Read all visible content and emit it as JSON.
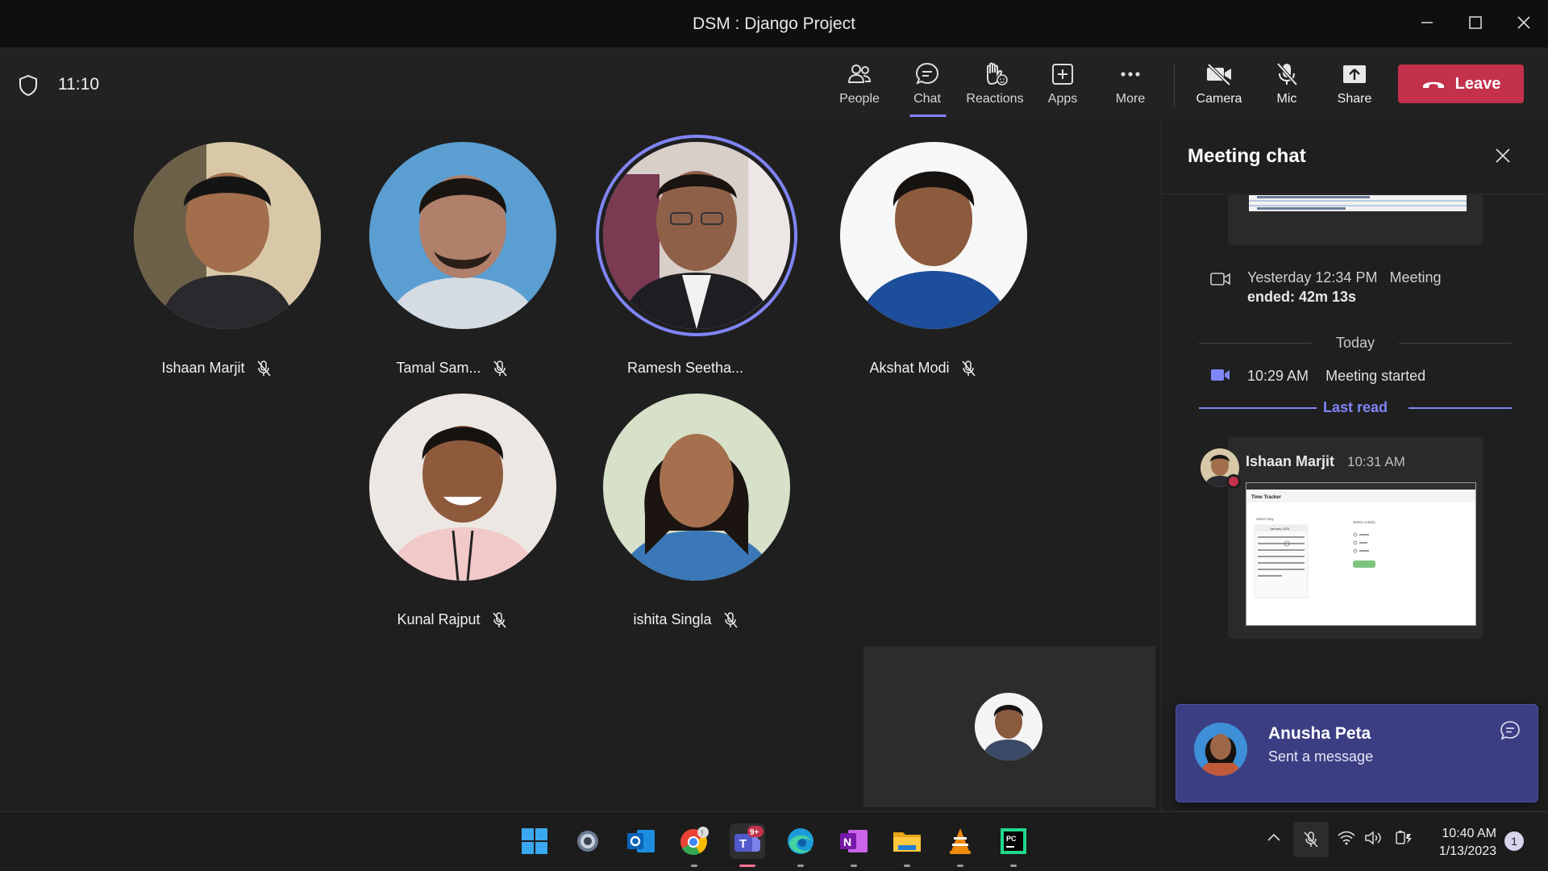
{
  "window": {
    "title": "DSM : Django Project"
  },
  "toolbar": {
    "timer": "11:10",
    "buttons": {
      "people": "People",
      "chat": "Chat",
      "reactions": "Reactions",
      "apps": "Apps",
      "more": "More",
      "camera": "Camera",
      "mic": "Mic",
      "share": "Share"
    },
    "leave": "Leave",
    "active_tab": "Chat",
    "leave_color": "#c4314b",
    "accent_color": "#7f85f5"
  },
  "participants": [
    {
      "name": "Ishaan Marjit",
      "muted": true
    },
    {
      "name": "Tamal Sam...",
      "muted": true
    },
    {
      "name": "Ramesh Seetha...",
      "muted": false,
      "speaking": true
    },
    {
      "name": "Akshat Modi",
      "muted": true
    },
    {
      "name": "Kunal Rajput",
      "muted": true
    },
    {
      "name": "ishita Singla",
      "muted": true
    }
  ],
  "chat": {
    "title": "Meeting chat",
    "ended_time": "Yesterday 12:34 PM",
    "ended_label": "Meeting",
    "ended_duration": "ended: 42m 13s",
    "today_label": "Today",
    "started_time": "10:29 AM",
    "started_label": "Meeting started",
    "last_read": "Last read",
    "message": {
      "author": "Ishaan Marjit",
      "time": "10:31 AM",
      "attachment_title": "Time Tracker",
      "attachment_month": "January 2023",
      "attachment_left_label": "Select Day",
      "attachment_right_label": "Select Activity"
    }
  },
  "toast": {
    "name": "Anusha Peta",
    "message": "Sent a message"
  },
  "taskbar": {
    "apps": [
      "windows-start",
      "settings",
      "outlook",
      "chrome",
      "teams",
      "edge",
      "onenote",
      "file-explorer",
      "vlc",
      "pycharm"
    ],
    "teams_badge": "9+",
    "time": "10:40 AM",
    "date": "1/13/2023",
    "notification_count": "1"
  }
}
